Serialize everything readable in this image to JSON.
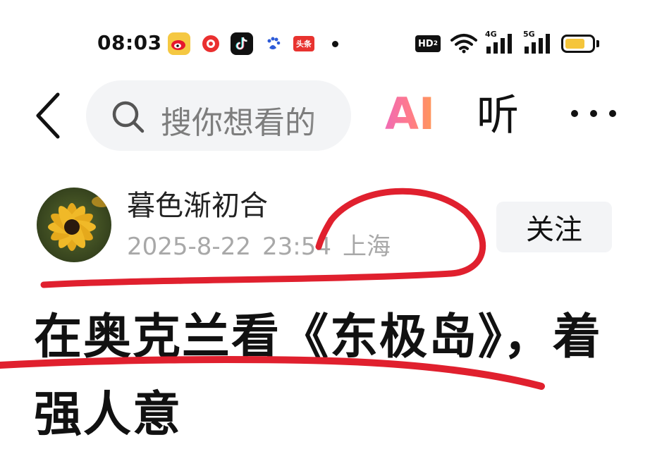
{
  "status_bar": {
    "time": "08:03",
    "notification_icons": [
      "weibo-icon",
      "xiaohongshu-icon",
      "tiktok-icon",
      "baidu-icon",
      "toutiao-icon"
    ],
    "toutiao_label": "头条",
    "hd_label": "HD",
    "hd_sub": "2",
    "signal_labels": [
      "4G",
      "5G"
    ],
    "battery_level": 0.75,
    "battery_color": "#f5c53a"
  },
  "nav": {
    "search_placeholder": "搜你想看的",
    "ai_label": "AI",
    "listen_label": "听"
  },
  "post": {
    "author": "暮色渐初合",
    "date": "2025-8-22",
    "time": "23:54",
    "location": "上海",
    "follow_label": "关注",
    "title": "在奥克兰看《东极岛》，着强人意"
  },
  "colors": {
    "annotation_red": "#e0202e",
    "meta_gray": "#a8a8a8",
    "search_bg": "#f3f4f6"
  }
}
